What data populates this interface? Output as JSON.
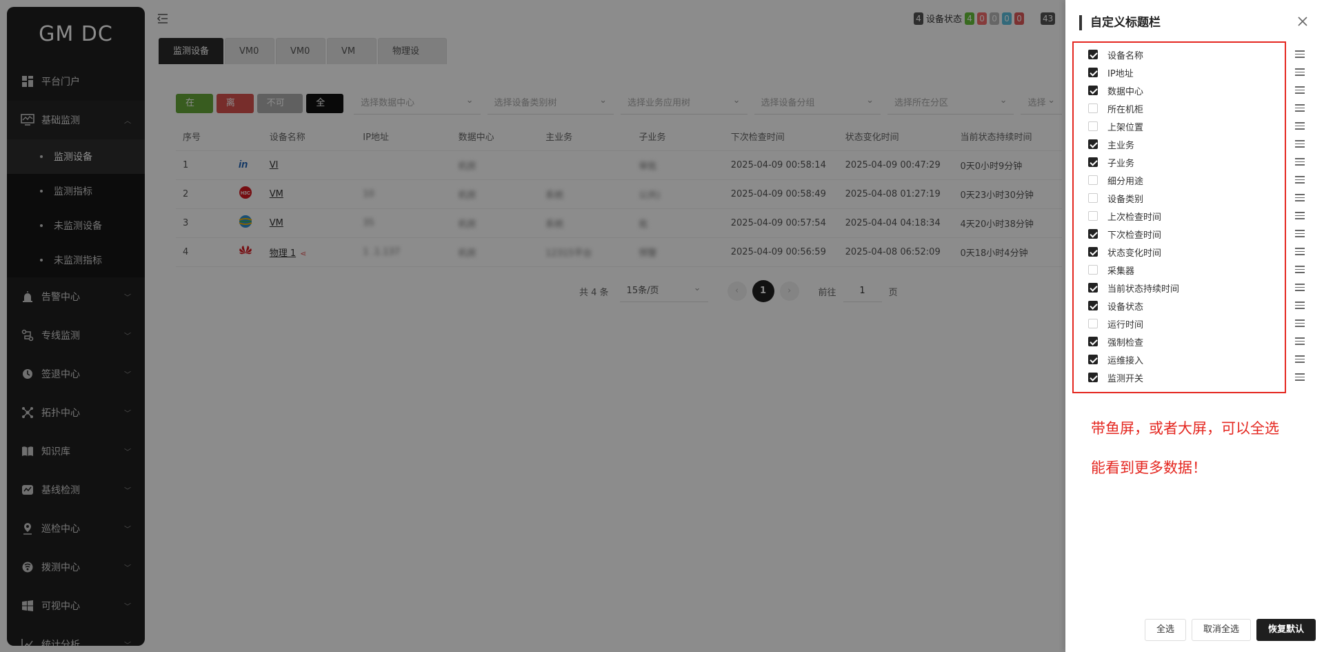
{
  "app": {
    "logo": "GM DC"
  },
  "sidebar": {
    "items": [
      {
        "label": "平台门户",
        "icon": "portal-icon"
      },
      {
        "label": "基础监测",
        "icon": "monitor-icon",
        "expanded": true
      },
      {
        "label": "告警中心",
        "icon": "alarm-icon"
      },
      {
        "label": "专线监测",
        "icon": "line-icon"
      },
      {
        "label": "签退中心",
        "icon": "clock-icon"
      },
      {
        "label": "拓扑中心",
        "icon": "topology-icon"
      },
      {
        "label": "知识库",
        "icon": "book-icon"
      },
      {
        "label": "基线检测",
        "icon": "baseline-icon"
      },
      {
        "label": "巡检中心",
        "icon": "location-icon"
      },
      {
        "label": "拨测中心",
        "icon": "dial-icon"
      },
      {
        "label": "可视中心",
        "icon": "windows-icon"
      },
      {
        "label": "统计分析",
        "icon": "chart-icon"
      }
    ],
    "submenu": [
      {
        "label": "监测设备",
        "active": true
      },
      {
        "label": "监测指标"
      },
      {
        "label": "未监测设备"
      },
      {
        "label": "未监测指标"
      }
    ]
  },
  "topbar": {
    "status_badge": "4",
    "status_label": "设备状态",
    "counts": [
      {
        "value": "4",
        "color": "#67c23a"
      },
      {
        "value": "0",
        "color": "#f56c6c"
      },
      {
        "value": "0",
        "color": "#bbbbbb"
      },
      {
        "value": "0",
        "color": "#5bc0de"
      },
      {
        "value": "0",
        "color": "#e05a5a"
      }
    ],
    "extra_badge": "43"
  },
  "tabs": [
    {
      "label": "监测设备",
      "active": true
    },
    {
      "label": "VM0"
    },
    {
      "label": "VM0"
    },
    {
      "label": "VM"
    },
    {
      "label": "物理设"
    }
  ],
  "filters": {
    "buttons": [
      {
        "label": "在线",
        "color": "#67a83a"
      },
      {
        "label": "离线",
        "color": "#d9534f"
      },
      {
        "label": "不可达",
        "color": "#b0b0b0"
      },
      {
        "label": "全部",
        "color": "#111111"
      }
    ],
    "selects": [
      "选择数据中心",
      "选择设备类别树",
      "选择业务应用树",
      "选择设备分组",
      "选择所在分区",
      "选择"
    ]
  },
  "table": {
    "headers": [
      "序号",
      "",
      "设备名称",
      "IP地址",
      "数据中心",
      "主业务",
      "子业务",
      "下次检查时间",
      "状态变化时间",
      "当前状态持续时间"
    ],
    "rows": [
      {
        "no": "1",
        "logo": "inspur-logo",
        "name": "VI",
        "ip": "",
        "dc": "机房",
        "main": "",
        "sub": "审批",
        "next": "2025-04-09 00:58:14",
        "change": "2025-04-09 00:47:29",
        "dur": "0天0小时9分钟"
      },
      {
        "no": "2",
        "logo": "h3c-logo",
        "name": "VM",
        "ip": "10",
        "dc": "机房",
        "main": "系统",
        "sub": "公共)",
        "next": "2025-04-09 00:58:49",
        "change": "2025-04-08 01:27:19",
        "dur": "0天23小时30分钟"
      },
      {
        "no": "3",
        "logo": "globe-logo",
        "name": "VM",
        "ip": "35",
        "dc": "机房",
        "main": "系统",
        "sub": "批",
        "next": "2025-04-09 00:57:54",
        "change": "2025-04-04 04:18:34",
        "dur": "4天20小时38分钟"
      },
      {
        "no": "4",
        "logo": "huawei-logo",
        "name": "物理 1",
        "ip": "1 .1.137",
        "dc": "机房",
        "main": "12315平台",
        "sub": "预警",
        "next": "2025-04-09 00:56:59",
        "change": "2025-04-08 06:52:09",
        "dur": "0天18小时4分钟"
      }
    ]
  },
  "pager": {
    "total": "共 4 条",
    "page_size": "15条/页",
    "current": "1",
    "goto_label": "前往",
    "goto_value": "1",
    "page_unit": "页"
  },
  "drawer": {
    "title": "自定义标题栏",
    "columns": [
      {
        "label": "设备名称",
        "checked": true
      },
      {
        "label": "IP地址",
        "checked": true
      },
      {
        "label": "数据中心",
        "checked": true
      },
      {
        "label": "所在机柜",
        "checked": false
      },
      {
        "label": "上架位置",
        "checked": false
      },
      {
        "label": "主业务",
        "checked": true
      },
      {
        "label": "子业务",
        "checked": true
      },
      {
        "label": "细分用途",
        "checked": false
      },
      {
        "label": "设备类别",
        "checked": false
      },
      {
        "label": "上次检查时间",
        "checked": false
      },
      {
        "label": "下次检查时间",
        "checked": true
      },
      {
        "label": "状态变化时间",
        "checked": true
      },
      {
        "label": "采集器",
        "checked": false
      },
      {
        "label": "当前状态持续时间",
        "checked": true
      },
      {
        "label": "设备状态",
        "checked": true
      },
      {
        "label": "运行时间",
        "checked": false
      },
      {
        "label": "强制检查",
        "checked": true
      },
      {
        "label": "运维接入",
        "checked": true
      },
      {
        "label": "监测开关",
        "checked": true
      }
    ],
    "note_line1": "带鱼屏，或者大屏，可以全选",
    "note_line2": "能看到更多数据！",
    "buttons": {
      "select_all": "全选",
      "deselect_all": "取消全选",
      "restore": "恢复默认"
    }
  }
}
